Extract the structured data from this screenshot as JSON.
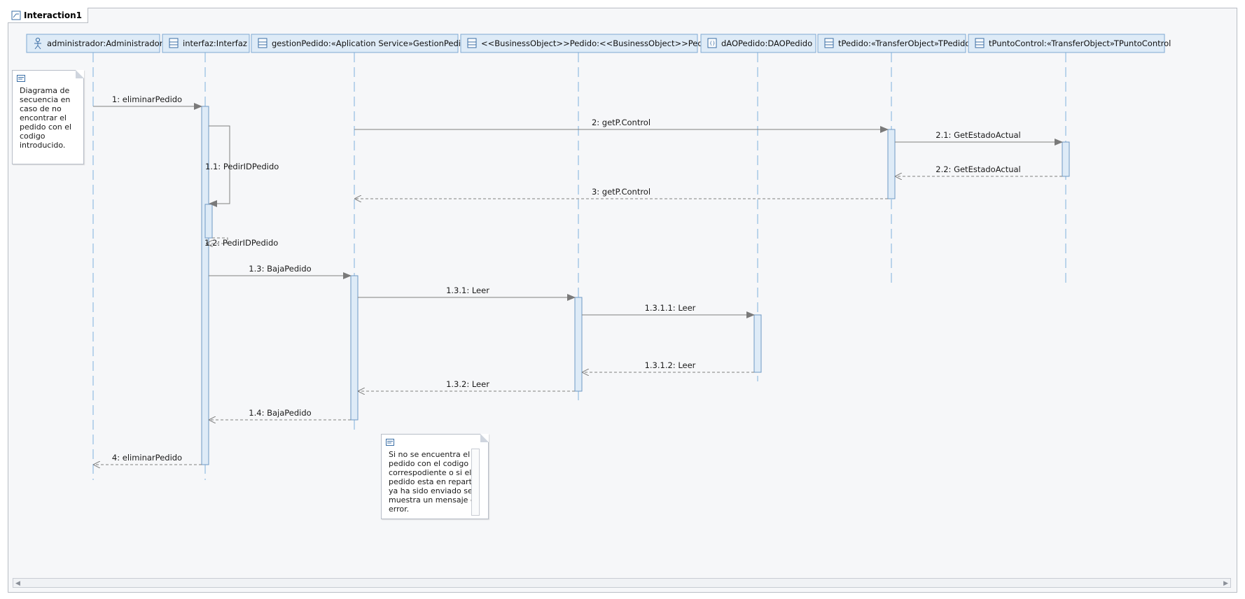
{
  "frame": {
    "title": "Interaction1"
  },
  "colors": {
    "header_fill": "#deebf7",
    "header_border": "#7da8d3",
    "lifeline": "#7fb0dd",
    "activation_fill": "#deebf7",
    "activation_border": "#6f98c4",
    "message": "#808080"
  },
  "lifelines": [
    {
      "id": "admin",
      "label": "administrador:Administrador",
      "icon": "actor-icon"
    },
    {
      "id": "interfaz",
      "label": "interfaz:Interfaz",
      "icon": "class-icon"
    },
    {
      "id": "gestion",
      "label": "gestionPedido:«Aplication Service»GestionPedido",
      "icon": "class-icon"
    },
    {
      "id": "pedido",
      "label": "<<BusinessObject>>Pedido:<<BusinessObject>>Pedido",
      "icon": "class-icon"
    },
    {
      "id": "dao",
      "label": "dAOPedido:DAOPedido",
      "icon": "component-icon"
    },
    {
      "id": "tpedido",
      "label": "tPedido:«TransferObject»TPedido",
      "icon": "class-icon"
    },
    {
      "id": "tpunto",
      "label": "tPuntoControl:«TransferObject»TPuntoControl",
      "icon": "class-icon"
    }
  ],
  "messages": [
    {
      "label": "1: eliminarPedido",
      "from": "admin",
      "to": "interfaz",
      "kind": "sync"
    },
    {
      "label": "2: getP.Control",
      "from": "gestion",
      "to": "tpedido",
      "kind": "sync"
    },
    {
      "label": "2.1: GetEstadoActual",
      "from": "tpedido",
      "to": "tpunto",
      "kind": "sync"
    },
    {
      "label": "1.1: PedirIDPedido",
      "from": "interfaz",
      "to": "interfaz",
      "kind": "self"
    },
    {
      "label": "2.2: GetEstadoActual",
      "from": "tpunto",
      "to": "tpedido",
      "kind": "reply"
    },
    {
      "label": "3: getP.Control",
      "from": "tpedido",
      "to": "gestion",
      "kind": "reply"
    },
    {
      "label": "1.2: PedirIDPedido",
      "from": "interfaz",
      "to": "interfaz",
      "kind": "self-reply"
    },
    {
      "label": "1.3: BajaPedido",
      "from": "interfaz",
      "to": "gestion",
      "kind": "sync"
    },
    {
      "label": "1.3.1: Leer",
      "from": "gestion",
      "to": "pedido",
      "kind": "sync"
    },
    {
      "label": "1.3.1.1: Leer",
      "from": "pedido",
      "to": "dao",
      "kind": "sync"
    },
    {
      "label": "1.3.1.2: Leer",
      "from": "dao",
      "to": "pedido",
      "kind": "reply"
    },
    {
      "label": "1.3.2: Leer",
      "from": "pedido",
      "to": "gestion",
      "kind": "reply"
    },
    {
      "label": "1.4: BajaPedido",
      "from": "gestion",
      "to": "interfaz",
      "kind": "reply"
    },
    {
      "label": "4: eliminarPedido",
      "from": "interfaz",
      "to": "admin",
      "kind": "reply"
    }
  ],
  "notes": [
    {
      "id": "note-1",
      "text": "Diagrama de\nsecuencia en\ncaso de no\nencontrar el\npedido con el\ncodigo\nintroducido."
    },
    {
      "id": "note-2",
      "text": "Si no se encuentra el\npedido con el codigo\ncorrespodiente o si el\npedido esta en reparto\nya ha sido enviado se\nmuestra un mensaje de\nerror."
    }
  ]
}
